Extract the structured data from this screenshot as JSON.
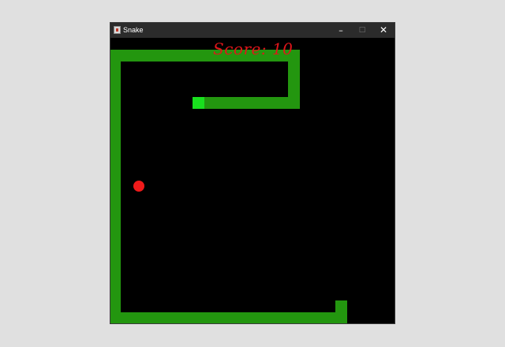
{
  "window": {
    "title": "Snake",
    "controls": {
      "minimize_glyph": "–",
      "maximize_glyph": "□",
      "close_glyph": "✕"
    }
  },
  "game": {
    "score_label": "Score: 10",
    "colors": {
      "background": "#000000",
      "snake_body": "#23960f",
      "snake_head": "#19e01e",
      "food": "#f01a1a",
      "score_text": "#e0161a"
    }
  }
}
